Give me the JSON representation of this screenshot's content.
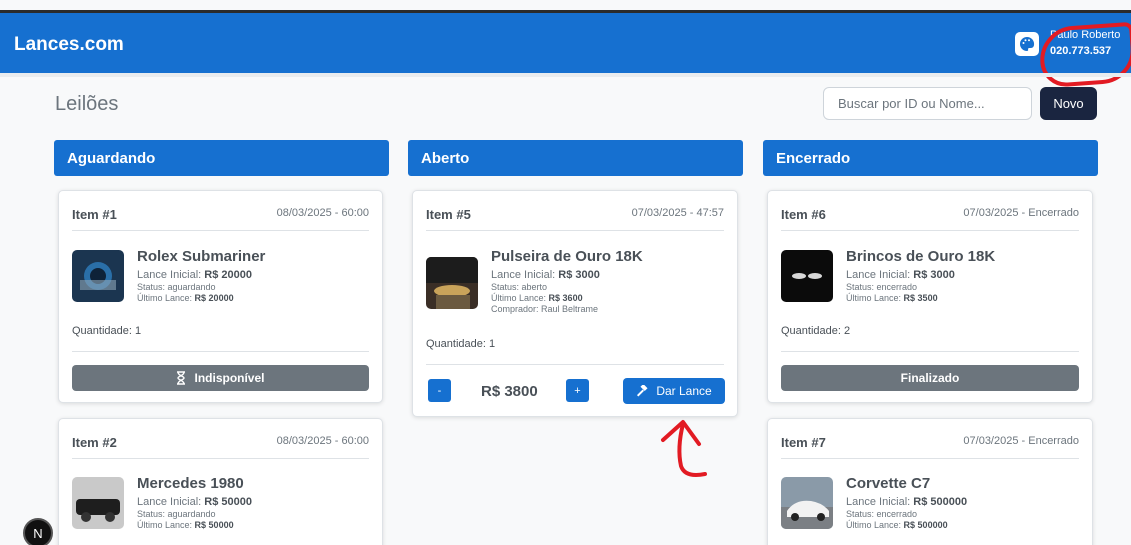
{
  "navbar": {
    "brand": "Lances.com",
    "user_name": "Paulo Roberto",
    "user_id": "020.773.537",
    "theme_icon": "palette-icon"
  },
  "toolbar": {
    "page_title": "Leilões",
    "search_placeholder": "Buscar por ID ou Nome...",
    "new_label": "Novo"
  },
  "columns": [
    {
      "title": "Aguardando"
    },
    {
      "title": "Aberto"
    },
    {
      "title": "Encerrado"
    }
  ],
  "cards": {
    "item1": {
      "id": "Item #1",
      "date": "08/03/2025 - 60:00",
      "name": "Rolex Submariner",
      "lance_inicial_label": "Lance Inicial:",
      "lance_inicial": "R$ 20000",
      "status": "Status: aguardando",
      "ultimo_label": "Último Lance:",
      "ultimo": "R$ 20000",
      "quantidade": "Quantidade: 1",
      "button": "Indisponível"
    },
    "item2": {
      "id": "Item #2",
      "date": "08/03/2025 - 60:00",
      "name": "Mercedes 1980",
      "lance_inicial_label": "Lance Inicial:",
      "lance_inicial": "R$ 50000",
      "status": "Status: aguardando",
      "ultimo_label": "Último Lance:",
      "ultimo": "R$ 50000"
    },
    "item5": {
      "id": "Item #5",
      "date": "07/03/2025 - 47:57",
      "name": "Pulseira de Ouro 18K",
      "lance_inicial_label": "Lance Inicial:",
      "lance_inicial": "R$ 3000",
      "status": "Status: aberto",
      "ultimo_label": "Último Lance:",
      "ultimo": "R$ 3600",
      "comprador": "Comprador: Raul Beltrame",
      "quantidade": "Quantidade: 1",
      "minus": "-",
      "plus": "+",
      "bid_value": "R$ 3800",
      "button": "Dar Lance"
    },
    "item6": {
      "id": "Item #6",
      "date": "07/03/2025 - Encerrado",
      "name": "Brincos de Ouro 18K",
      "lance_inicial_label": "Lance Inicial:",
      "lance_inicial": "R$ 3000",
      "status": "Status: encerrado",
      "ultimo_label": "Último Lance:",
      "ultimo": "R$ 3500",
      "quantidade": "Quantidade: 2",
      "button": "Finalizado"
    },
    "item7": {
      "id": "Item #7",
      "date": "07/03/2025 - Encerrado",
      "name": "Corvette C7",
      "lance_inicial_label": "Lance Inicial:",
      "lance_inicial": "R$ 500000",
      "status": "Status: encerrado",
      "ultimo_label": "Último Lance:",
      "ultimo": "R$ 500000"
    }
  },
  "badge": {
    "letter": "N"
  },
  "colors": {
    "primary": "#1670d0",
    "dark_button": "#1a2540",
    "disabled": "#6c757d",
    "annotation": "#e21b23"
  }
}
